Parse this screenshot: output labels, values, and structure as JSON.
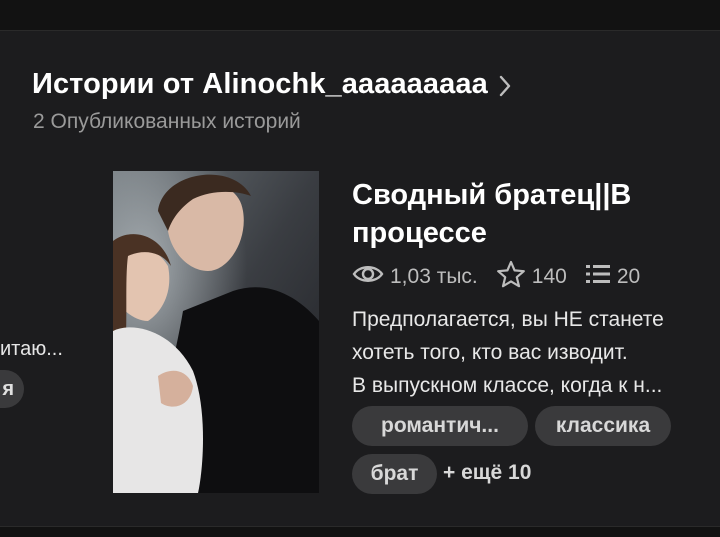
{
  "section": {
    "title": "Истории от Alinochk_aaaaaaaaa",
    "subtitle": "2 Опубликованных историй"
  },
  "previous_card": {
    "description_fragment": "итаю...",
    "tag_fragment": "я"
  },
  "story": {
    "title": "Сводный братец||В процессе",
    "stats": {
      "reads": "1,03 тыс.",
      "votes": "140",
      "parts": "20"
    },
    "description": "Предполагается, вы НЕ станете\nхотеть того, кто вас изводит.\nВ выпускном классе, когда к н...",
    "tags": [
      "романтич...",
      "классика",
      "брат"
    ],
    "more_tags": "+ ещё 10"
  },
  "icons": [
    "chevron-right-icon",
    "eye-icon",
    "star-icon",
    "list-icon"
  ],
  "colors": {
    "background": "#121212",
    "panel": "#1c1c1e",
    "tag_background": "#3a3a3c",
    "secondary_text": "#9a9a9a"
  }
}
